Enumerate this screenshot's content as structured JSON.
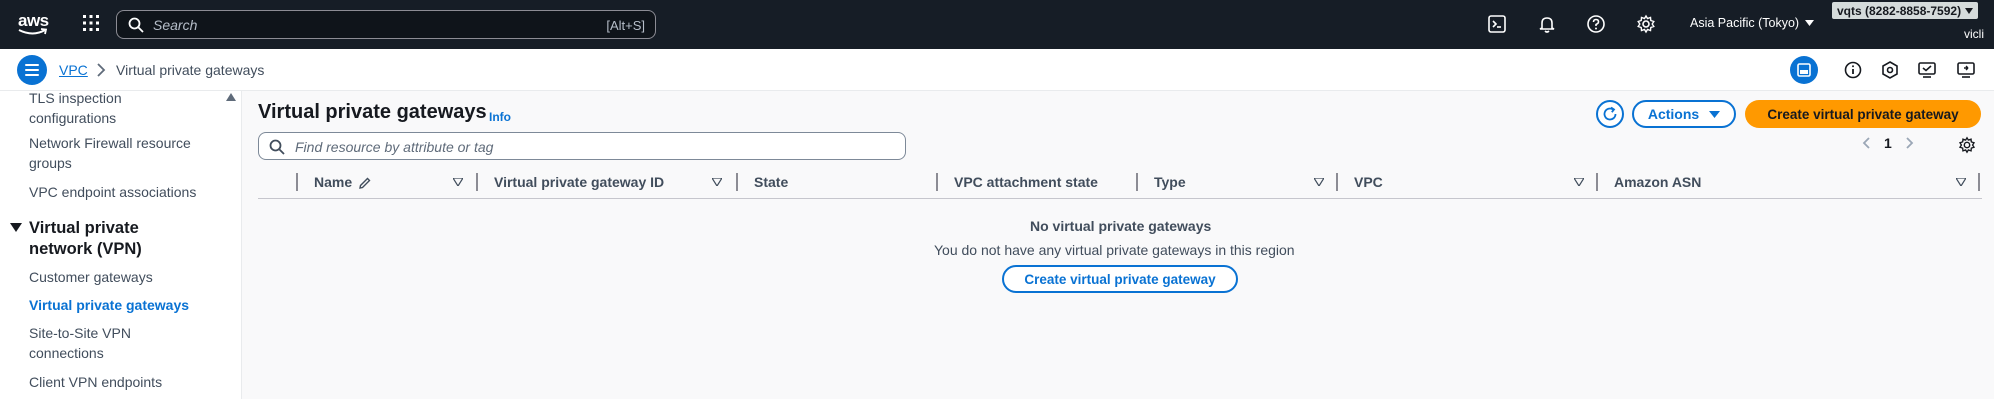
{
  "topnav": {
    "logo_text": "aws",
    "search_placeholder": "Search",
    "search_shortcut": "[Alt+S]",
    "region_label": "Asia Pacific (Tokyo)",
    "account_label": "vqts (8282-8858-7592)",
    "user_label": "vicli",
    "icons": [
      "services-grid-icon",
      "cloudshell-icon",
      "bell-icon",
      "help-icon",
      "gear-icon"
    ]
  },
  "breadcrumb": {
    "items": [
      "VPC",
      "Virtual private gateways"
    ]
  },
  "sidebar": {
    "items_above": [
      "TLS inspection configurations",
      "Network Firewall resource groups",
      "VPC endpoint associations"
    ],
    "section_title": "Virtual private network (VPN)",
    "section_items": [
      "Customer gateways",
      "Virtual private gateways",
      "Site-to-Site VPN connections",
      "Client VPN endpoints"
    ],
    "active_item": "Virtual private gateways"
  },
  "main": {
    "title": "Virtual private gateways",
    "info_label": "Info",
    "actions_label": "Actions",
    "create_label": "Create virtual private gateway",
    "filter_placeholder": "Find resource by attribute or tag",
    "page_number": "1",
    "columns": [
      "Name",
      "Virtual private gateway ID",
      "State",
      "VPC attachment state",
      "Type",
      "VPC",
      "Amazon ASN"
    ],
    "empty_title": "No virtual private gateways",
    "empty_description": "You do not have any virtual private gateways in this region",
    "empty_create_label": "Create virtual private gateway"
  },
  "colors": {
    "nav_bg": "#161d26",
    "link_blue": "#0972d3",
    "primary_orange": "#ff9900"
  }
}
